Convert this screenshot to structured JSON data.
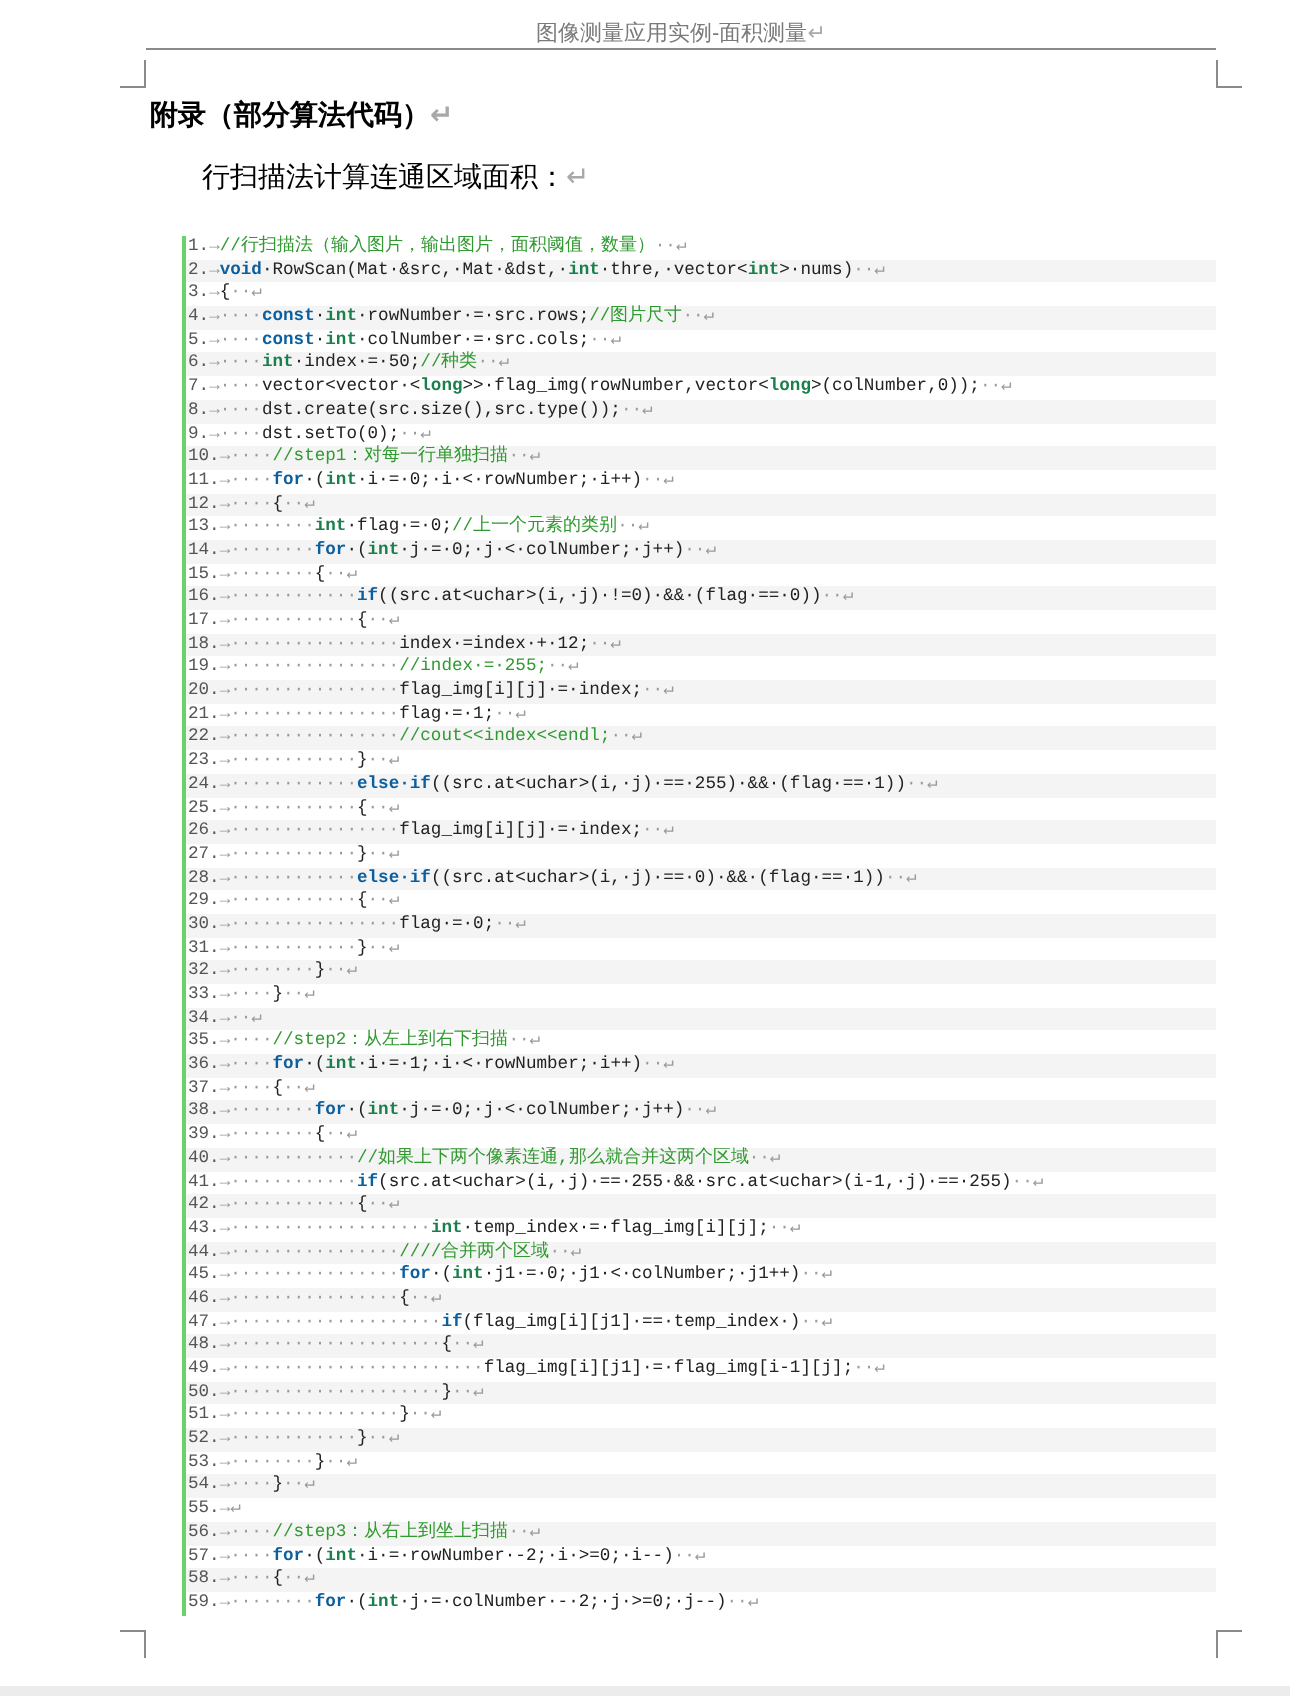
{
  "header": {
    "title": "图像测量应用实例-面积测量",
    "mark": "↵"
  },
  "heading": {
    "text": "附录（部分算法代码）",
    "mark": "↵"
  },
  "subheading": {
    "text": "行扫描法计算连通区域面积：",
    "mark": "↵"
  },
  "code_lines": [
    {
      "num": "1.",
      "indent": "→",
      "segs": [
        {
          "kind": "comment",
          "text": "//行扫描法（输入图片，输出图片，面积阈值，数量）"
        }
      ],
      "end": "··↵"
    },
    {
      "num": "2.",
      "indent": "→",
      "segs": [
        {
          "kind": "keyword",
          "text": "void"
        },
        "·RowScan(Mat·&src,·Mat·&dst,·",
        {
          "kind": "type",
          "text": "int"
        },
        "·thre,·vector<",
        {
          "kind": "type",
          "text": "int"
        },
        ">·nums)"
      ],
      "end": "··↵"
    },
    {
      "num": "3.",
      "indent": "→",
      "segs": [
        "{"
      ],
      "end": "··↵"
    },
    {
      "num": "4.",
      "indent": "→····",
      "segs": [
        {
          "kind": "keyword",
          "text": "const"
        },
        "·",
        {
          "kind": "type",
          "text": "int"
        },
        "·rowNumber·=·src.rows;",
        {
          "kind": "comment",
          "text": "//图片尺寸"
        }
      ],
      "end": "··↵"
    },
    {
      "num": "5.",
      "indent": "→····",
      "segs": [
        {
          "kind": "keyword",
          "text": "const"
        },
        "·",
        {
          "kind": "type",
          "text": "int"
        },
        "·colNumber·=·src.cols;"
      ],
      "end": "··↵"
    },
    {
      "num": "6.",
      "indent": "→····",
      "segs": [
        {
          "kind": "type",
          "text": "int"
        },
        "·index·=·50;",
        {
          "kind": "comment",
          "text": "//种类"
        }
      ],
      "end": "··↵"
    },
    {
      "num": "7.",
      "indent": "→····",
      "segs": [
        "vector<vector·<",
        {
          "kind": "type",
          "text": "long"
        },
        ">>·flag_img(rowNumber,vector<",
        {
          "kind": "type",
          "text": "long"
        },
        ">(colNumber,0));"
      ],
      "end": "··↵"
    },
    {
      "num": "8.",
      "indent": "→····",
      "segs": [
        "dst.create(src.size(),src.type());"
      ],
      "end": "··↵"
    },
    {
      "num": "9.",
      "indent": "→····",
      "segs": [
        "dst.setTo(0);"
      ],
      "end": "··↵"
    },
    {
      "num": "10.",
      "indent": "→····",
      "segs": [
        {
          "kind": "comment",
          "text": "//step1：对每一行单独扫描"
        }
      ],
      "end": "··↵"
    },
    {
      "num": "11.",
      "indent": "→····",
      "segs": [
        {
          "kind": "keyword",
          "text": "for"
        },
        "·(",
        {
          "kind": "type",
          "text": "int"
        },
        "·i·=·0;·i·<·rowNumber;·i++)"
      ],
      "end": "··↵"
    },
    {
      "num": "12.",
      "indent": "→····",
      "segs": [
        "{"
      ],
      "end": "··↵"
    },
    {
      "num": "13.",
      "indent": "→········",
      "segs": [
        {
          "kind": "type",
          "text": "int"
        },
        "·flag·=·0;",
        {
          "kind": "comment",
          "text": "//上一个元素的类别"
        }
      ],
      "end": "··↵"
    },
    {
      "num": "14.",
      "indent": "→········",
      "segs": [
        {
          "kind": "keyword",
          "text": "for"
        },
        "·(",
        {
          "kind": "type",
          "text": "int"
        },
        "·j·=·0;·j·<·colNumber;·j++)"
      ],
      "end": "··↵"
    },
    {
      "num": "15.",
      "indent": "→········",
      "segs": [
        "{"
      ],
      "end": "··↵"
    },
    {
      "num": "16.",
      "indent": "→············",
      "segs": [
        {
          "kind": "keyword",
          "text": "if"
        },
        "((src.at<uchar>(i,·j)·!=0)·&&·(flag·==·0))"
      ],
      "end": "··↵"
    },
    {
      "num": "17.",
      "indent": "→············",
      "segs": [
        "{"
      ],
      "end": "··↵"
    },
    {
      "num": "18.",
      "indent": "→················",
      "segs": [
        "index·=index·+·12;"
      ],
      "end": "··↵"
    },
    {
      "num": "19.",
      "indent": "→················",
      "segs": [
        {
          "kind": "comment",
          "text": "//index·=·255;"
        }
      ],
      "end": "··↵"
    },
    {
      "num": "20.",
      "indent": "→················",
      "segs": [
        "flag_img[i][j]·=·index;"
      ],
      "end": "··↵"
    },
    {
      "num": "21.",
      "indent": "→················",
      "segs": [
        "flag·=·1;"
      ],
      "end": "··↵"
    },
    {
      "num": "22.",
      "indent": "→················",
      "segs": [
        {
          "kind": "comment",
          "text": "//cout<<index<<endl;"
        }
      ],
      "end": "··↵"
    },
    {
      "num": "23.",
      "indent": "→············",
      "segs": [
        "}"
      ],
      "end": "··↵"
    },
    {
      "num": "24.",
      "indent": "→············",
      "segs": [
        {
          "kind": "keyword",
          "text": "else·if"
        },
        "((src.at<uchar>(i,·j)·==·255)·&&·(flag·==·1))"
      ],
      "end": "··↵"
    },
    {
      "num": "25.",
      "indent": "→············",
      "segs": [
        "{"
      ],
      "end": "··↵"
    },
    {
      "num": "26.",
      "indent": "→················",
      "segs": [
        "flag_img[i][j]·=·index;"
      ],
      "end": "··↵"
    },
    {
      "num": "27.",
      "indent": "→············",
      "segs": [
        "}"
      ],
      "end": "··↵"
    },
    {
      "num": "28.",
      "indent": "→············",
      "segs": [
        {
          "kind": "keyword",
          "text": "else·if"
        },
        "((src.at<uchar>(i,·j)·==·0)·&&·(flag·==·1))"
      ],
      "end": "··↵"
    },
    {
      "num": "29.",
      "indent": "→············",
      "segs": [
        "{"
      ],
      "end": "··↵"
    },
    {
      "num": "30.",
      "indent": "→················",
      "segs": [
        "flag·=·0;"
      ],
      "end": "··↵"
    },
    {
      "num": "31.",
      "indent": "→············",
      "segs": [
        "}"
      ],
      "end": "··↵"
    },
    {
      "num": "32.",
      "indent": "→········",
      "segs": [
        "}"
      ],
      "end": "··↵"
    },
    {
      "num": "33.",
      "indent": "→····",
      "segs": [
        "}"
      ],
      "end": "··↵"
    },
    {
      "num": "34.",
      "indent": "→",
      "end": "··↵"
    },
    {
      "num": "35.",
      "indent": "→····",
      "segs": [
        {
          "kind": "comment",
          "text": "//step2：从左上到右下扫描"
        }
      ],
      "end": "··↵"
    },
    {
      "num": "36.",
      "indent": "→····",
      "segs": [
        {
          "kind": "keyword",
          "text": "for"
        },
        "·(",
        {
          "kind": "type",
          "text": "int"
        },
        "·i·=·1;·i·<·rowNumber;·i++)"
      ],
      "end": "··↵"
    },
    {
      "num": "37.",
      "indent": "→····",
      "segs": [
        "{"
      ],
      "end": "··↵"
    },
    {
      "num": "38.",
      "indent": "→········",
      "segs": [
        {
          "kind": "keyword",
          "text": "for"
        },
        "·(",
        {
          "kind": "type",
          "text": "int"
        },
        "·j·=·0;·j·<·colNumber;·j++)"
      ],
      "end": "··↵"
    },
    {
      "num": "39.",
      "indent": "→········",
      "segs": [
        "{"
      ],
      "end": "··↵"
    },
    {
      "num": "40.",
      "indent": "→············",
      "segs": [
        {
          "kind": "comment",
          "text": "//如果上下两个像素连通,那么就合并这两个区域"
        }
      ],
      "end": "··↵"
    },
    {
      "num": "41.",
      "indent": "→············",
      "segs": [
        {
          "kind": "keyword",
          "text": "if"
        },
        "(src.at<uchar>(i,·j)·==·255·&&·src.at<uchar>(i-1,·j)·==·255)"
      ],
      "end": "··↵"
    },
    {
      "num": "42.",
      "indent": "→············",
      "segs": [
        "{"
      ],
      "end": "··↵"
    },
    {
      "num": "43.",
      "indent": "→···················",
      "segs": [
        {
          "kind": "type",
          "text": "int"
        },
        "·temp_index·=·flag_img[i][j];"
      ],
      "end": "··↵"
    },
    {
      "num": "44.",
      "indent": "→················",
      "segs": [
        {
          "kind": "comment",
          "text": "////合并两个区域"
        }
      ],
      "end": "··↵"
    },
    {
      "num": "45.",
      "indent": "→················",
      "segs": [
        {
          "kind": "keyword",
          "text": "for"
        },
        "·(",
        {
          "kind": "type",
          "text": "int"
        },
        "·j1·=·0;·j1·<·colNumber;·j1++)"
      ],
      "end": "··↵"
    },
    {
      "num": "46.",
      "indent": "→················",
      "segs": [
        "{"
      ],
      "end": "··↵"
    },
    {
      "num": "47.",
      "indent": "→····················",
      "segs": [
        {
          "kind": "keyword",
          "text": "if"
        },
        "(flag_img[i][j1]·==·temp_index·)"
      ],
      "end": "··↵"
    },
    {
      "num": "48.",
      "indent": "→····················",
      "segs": [
        "{"
      ],
      "end": "··↵"
    },
    {
      "num": "49.",
      "indent": "→························",
      "segs": [
        "flag_img[i][j1]·=·flag_img[i-1][j];"
      ],
      "end": "··↵"
    },
    {
      "num": "50.",
      "indent": "→····················",
      "segs": [
        "}"
      ],
      "end": "··↵"
    },
    {
      "num": "51.",
      "indent": "→················",
      "segs": [
        "}"
      ],
      "end": "··↵"
    },
    {
      "num": "52.",
      "indent": "→············",
      "segs": [
        "}"
      ],
      "end": "··↵"
    },
    {
      "num": "53.",
      "indent": "→········",
      "segs": [
        "}"
      ],
      "end": "··↵"
    },
    {
      "num": "54.",
      "indent": "→····",
      "segs": [
        "}"
      ],
      "end": "··↵"
    },
    {
      "num": "55.",
      "indent": "→",
      "end": "↵"
    },
    {
      "num": "56.",
      "indent": "→····",
      "segs": [
        {
          "kind": "comment",
          "text": "//step3：从右上到坐上扫描"
        }
      ],
      "end": "··↵"
    },
    {
      "num": "57.",
      "indent": "→····",
      "segs": [
        {
          "kind": "keyword",
          "text": "for"
        },
        "·(",
        {
          "kind": "type",
          "text": "int"
        },
        "·i·=·rowNumber·-2;·i·>=0;·i--)"
      ],
      "end": "··↵"
    },
    {
      "num": "58.",
      "indent": "→····",
      "segs": [
        "{"
      ],
      "end": "··↵"
    },
    {
      "num": "59.",
      "indent": "→········",
      "segs": [
        {
          "kind": "keyword",
          "text": "for"
        },
        "·(",
        {
          "kind": "type",
          "text": "int"
        },
        "·j·=·colNumber·-·2;·j·>=0;·j--)"
      ],
      "end": "··↵"
    }
  ]
}
